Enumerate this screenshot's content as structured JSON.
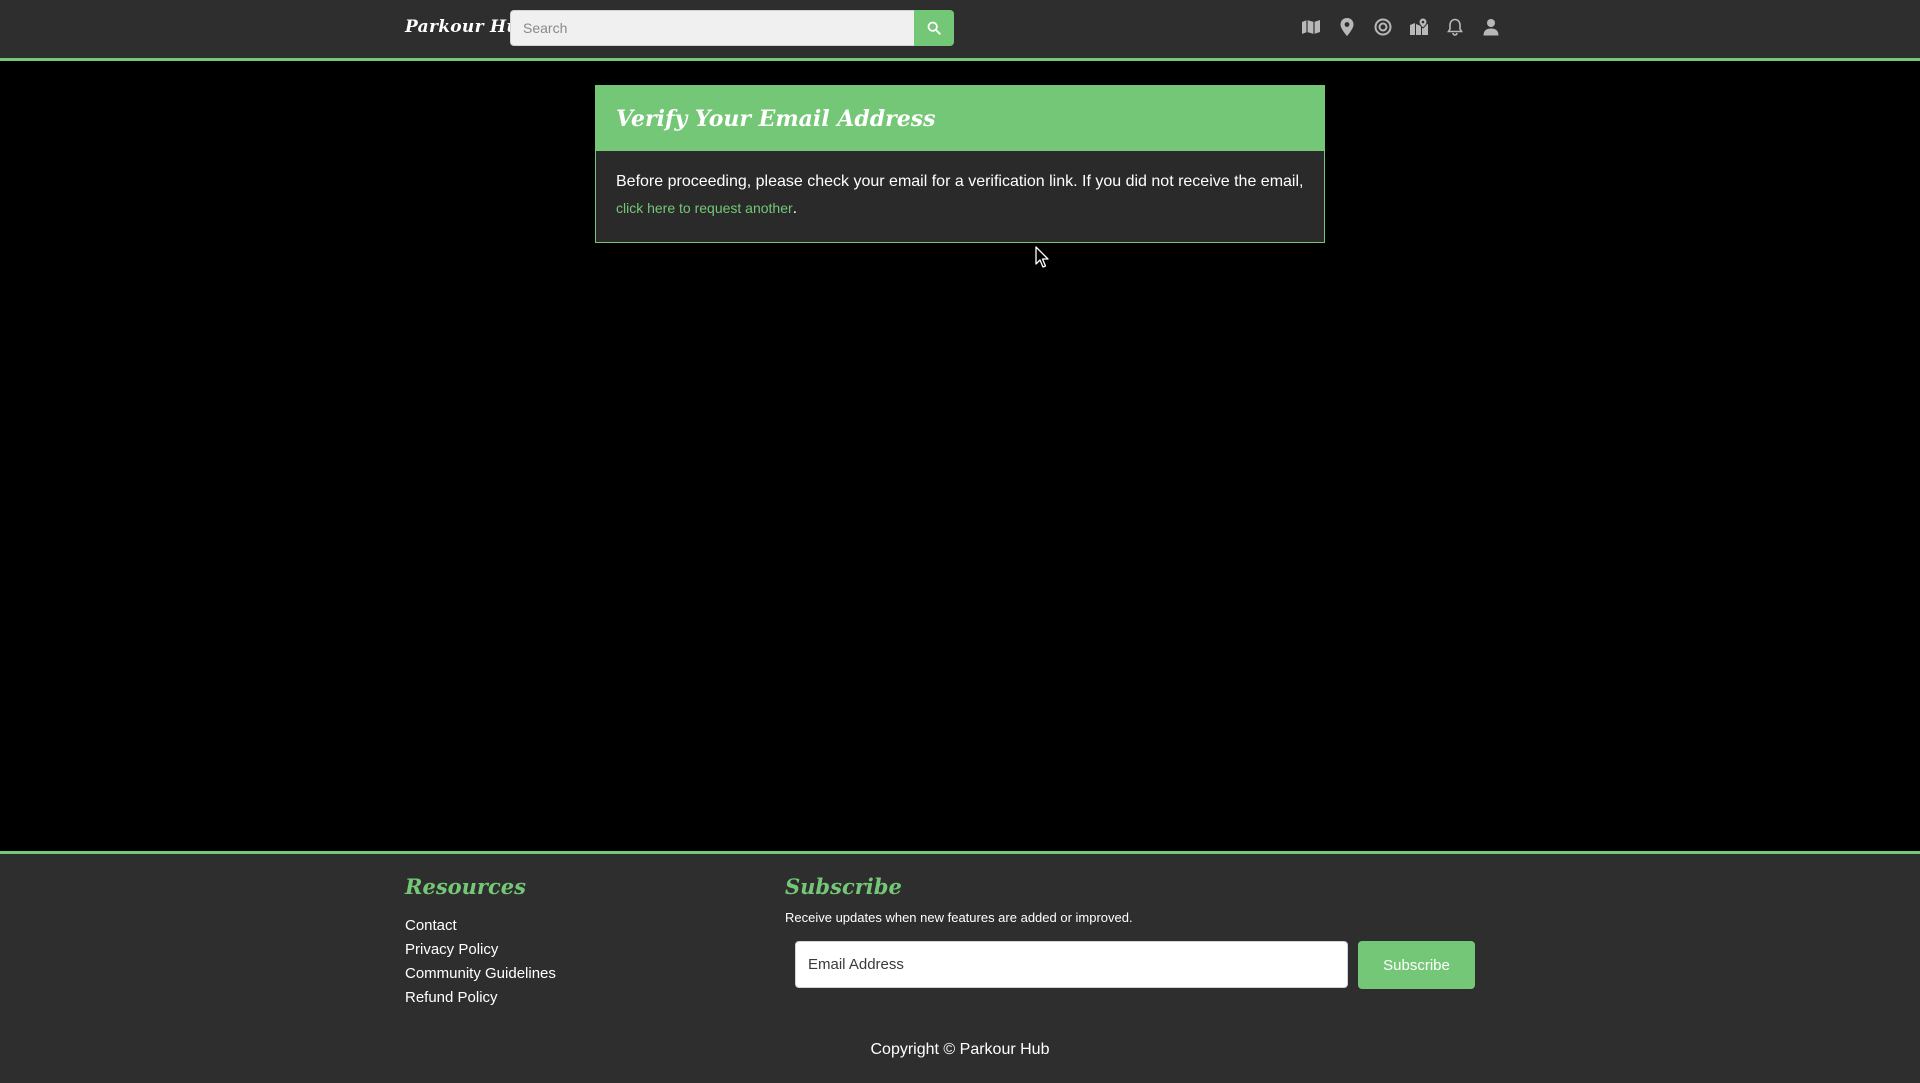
{
  "navbar": {
    "brand": "Parkour Hub",
    "search": {
      "placeholder": "Search",
      "value": ""
    },
    "icons": [
      "map-icon",
      "location-pin-icon",
      "target-icon",
      "map-location-icon",
      "bell-icon",
      "user-icon"
    ]
  },
  "card": {
    "title": "Verify Your Email Address",
    "body_text": "Before proceeding, please check your email for a verification link. If you did not receive the email,",
    "link_text": "click here to request another",
    "trailing": "."
  },
  "footer": {
    "resources_heading": "Resources",
    "resources_links": [
      "Contact",
      "Privacy Policy",
      "Community Guidelines",
      "Refund Policy"
    ],
    "subscribe_heading": "Subscribe",
    "subscribe_description": "Receive updates when new features are added or improved.",
    "email_placeholder": "Email Address",
    "subscribe_button": "Subscribe",
    "copyright": "Copyright © Parkour Hub"
  },
  "colors": {
    "accent": "#74c776",
    "navbar_bg": "#2e2e2e",
    "card_bg": "#2a2a2a",
    "page_bg": "#000000"
  }
}
